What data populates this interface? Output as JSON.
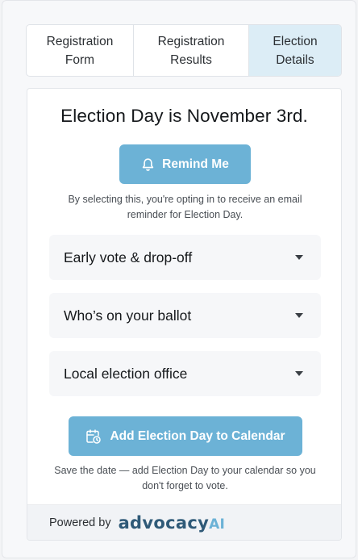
{
  "tabs": [
    {
      "label_line1": "Registration",
      "label_line2": "Form",
      "active": false
    },
    {
      "label_line1": "Registration",
      "label_line2": "Results",
      "active": false
    },
    {
      "label_line1": "Election",
      "label_line2": "Details",
      "active": true
    }
  ],
  "election": {
    "title": "Election Day is November 3rd.",
    "remind_label": "Remind Me",
    "remind_note": "By selecting this, you're opting in to receive an email reminder for Election Day."
  },
  "accordions": [
    {
      "label": "Early vote & drop-off",
      "icon": "caret-down-icon"
    },
    {
      "label": "Who’s on your ballot",
      "icon": "caret-down-icon"
    },
    {
      "label": "Local election office",
      "icon": "caret-down-icon"
    }
  ],
  "calendar": {
    "button_label": "Add Election Day to Calendar",
    "note": "Save the date — add Election Day to your calendar so you don't forget to vote."
  },
  "footer": {
    "powered_by": "Powered by",
    "brand_main": "advocacy",
    "brand_suffix": "AI"
  },
  "colors": {
    "accent": "#6cb2d6",
    "active_tab": "#dcedf6",
    "brand": "#2f5a78"
  }
}
